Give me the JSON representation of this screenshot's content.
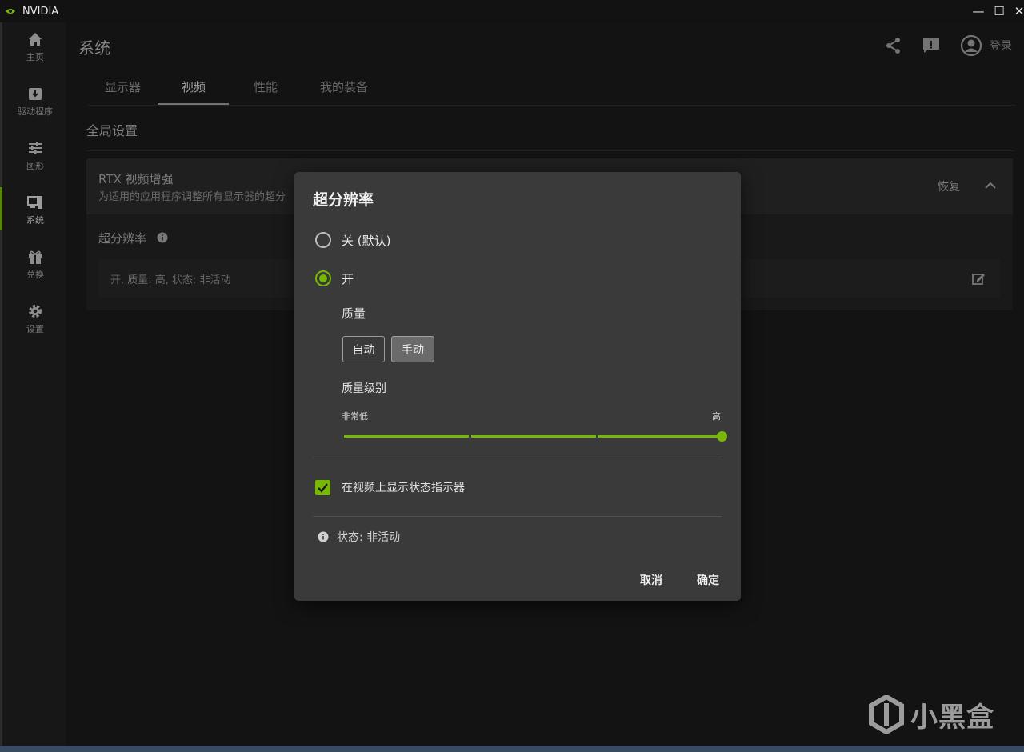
{
  "app": {
    "title": "NVIDIA",
    "minimize": "—",
    "maximize": "☐",
    "close": "✕"
  },
  "sidebar": {
    "items": [
      {
        "label": "主页",
        "icon": "home-icon"
      },
      {
        "label": "驱动程序",
        "icon": "driver-download-icon"
      },
      {
        "label": "图形",
        "icon": "sliders-icon"
      },
      {
        "label": "系统",
        "icon": "system-monitor-icon",
        "active": true
      },
      {
        "label": "兑换",
        "icon": "gift-icon"
      },
      {
        "label": "设置",
        "icon": "gear-icon"
      }
    ]
  },
  "header": {
    "title": "系统",
    "icons": [
      "share-icon",
      "feedback-icon",
      "user-avatar-icon"
    ],
    "login": "登录"
  },
  "tabs": [
    {
      "label": "显示器"
    },
    {
      "label": "视频",
      "active": true
    },
    {
      "label": "性能"
    },
    {
      "label": "我的装备"
    }
  ],
  "section": {
    "title": "全局设置"
  },
  "panel": {
    "title": "RTX 视频增强",
    "subtitle": "为适用的应用程序调整所有显示器的超分",
    "restore": "恢复",
    "setting_label": "超分辨率",
    "setting_value": "开, 质量:  高, 状态:  非活动"
  },
  "dialog": {
    "title": "超分辨率",
    "options": [
      {
        "label": "关 (默认)",
        "selected": false
      },
      {
        "label": "开",
        "selected": true
      }
    ],
    "quality_label": "质量",
    "quality_buttons": [
      {
        "label": "自动",
        "selected": false
      },
      {
        "label": "手动",
        "selected": true
      }
    ],
    "quality_level_label": "质量级别",
    "slider": {
      "min_label": "非常低",
      "max_label": "高",
      "value": "高"
    },
    "checkbox": {
      "label": "在视频上显示状态指示器",
      "checked": true
    },
    "status": "状态:  非活动",
    "cancel": "取消",
    "confirm": "确定"
  },
  "watermark": {
    "text": "小黑盒"
  },
  "colors": {
    "accent": "#76b900",
    "background": "#1a1a1a",
    "dialog": "#3a3a3a"
  }
}
